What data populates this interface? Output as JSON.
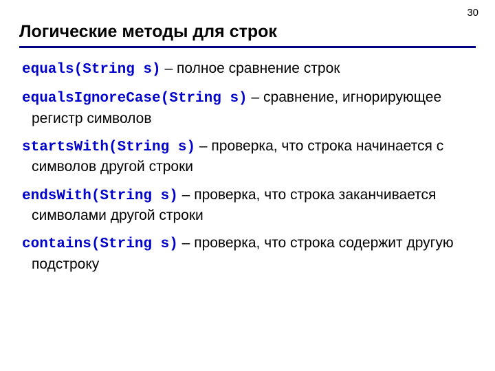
{
  "page_number": "30",
  "title": "Логические методы для строк",
  "items": [
    {
      "code": "equals(String s)",
      "sep": " – ",
      "desc": "полное сравнение строк"
    },
    {
      "code": "equalsIgnoreCase(String s)",
      "sep": "  – ",
      "desc": "сравнение, игнорирующее регистр символов"
    },
    {
      "code": "startsWith(String s)",
      "sep": "  – ",
      "desc": "проверка, что строка начинается с символов другой строки"
    },
    {
      "code": "endsWith(String s)",
      "sep": "  – ",
      "desc": "проверка, что строка заканчивается символами другой строки"
    },
    {
      "code": "contains(String s)",
      "sep": "  – ",
      "desc": "проверка, что строка содержит другую подстроку"
    }
  ]
}
